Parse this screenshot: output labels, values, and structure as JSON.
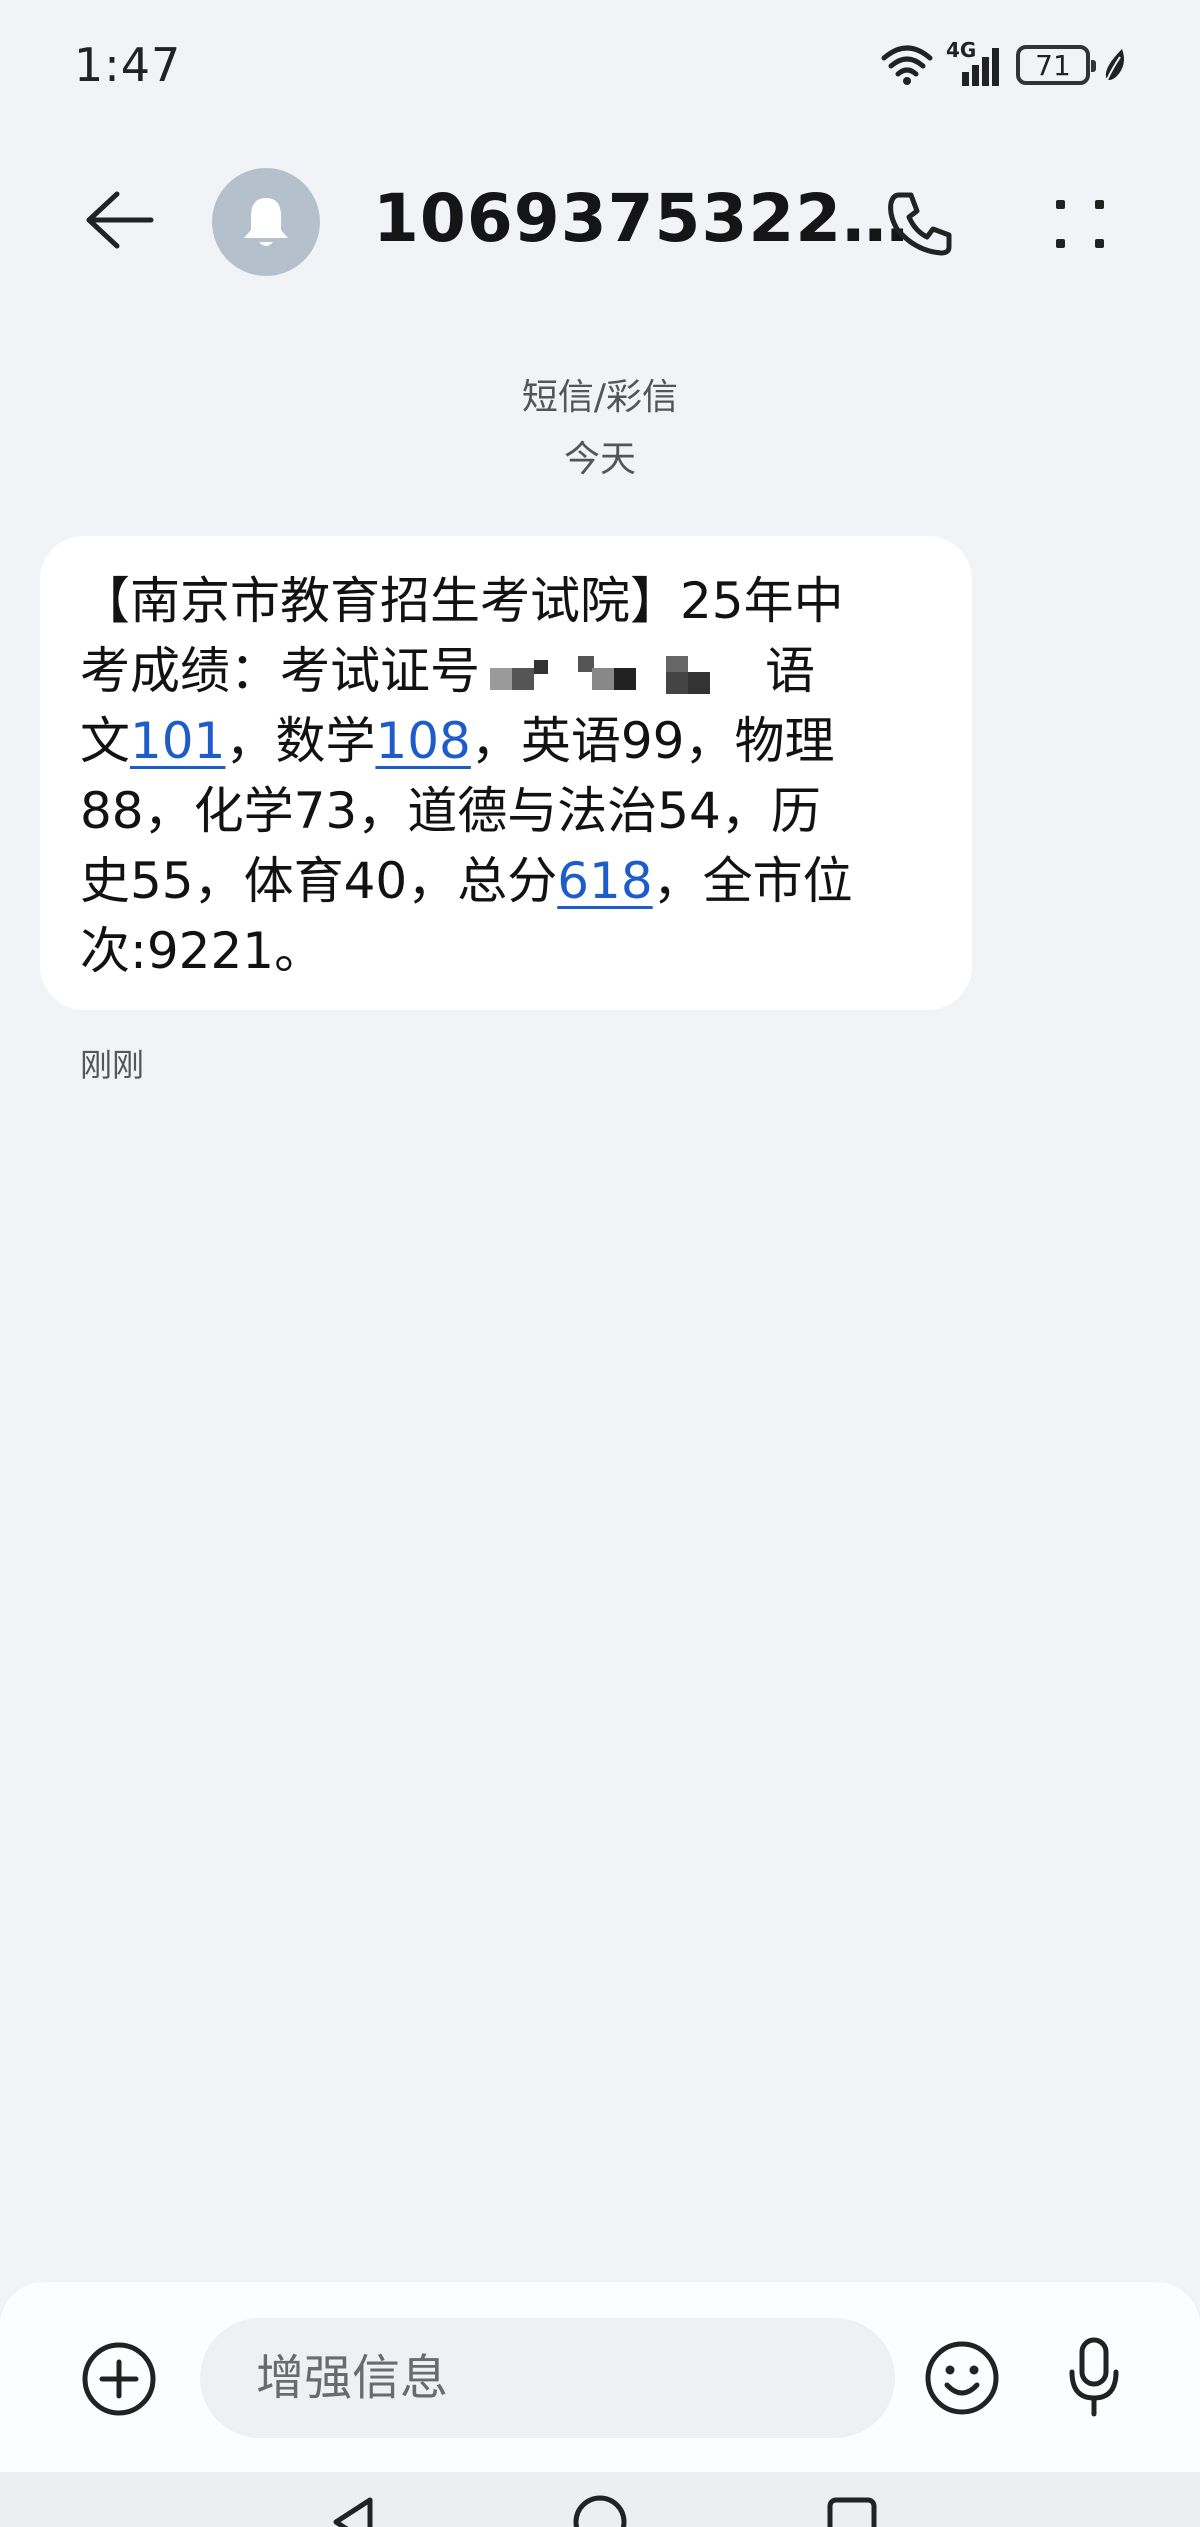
{
  "status_bar": {
    "time": "1:47",
    "network": "4G",
    "battery": "71"
  },
  "header": {
    "title": "1069375322…",
    "back_icon": "back-arrow-icon",
    "avatar_icon": "bell-icon",
    "call_icon": "phone-icon",
    "more_icon": "more-dots-icon"
  },
  "conversation": {
    "message_type": "短信/彩信",
    "date_separator": "今天",
    "message": {
      "line1": "【南京市教育招生考试院】25年中",
      "line2_pre": "考成绩：考试证号",
      "line2_post": "语",
      "line3_a": "文",
      "link1": "101",
      "line3_b": "，数学",
      "link2": "108",
      "line3_c": "，英语99，物理",
      "line4": "88，化学73，道德与法治54，历",
      "line5_a": "史55，体育40，总分",
      "link3": "618",
      "line5_b": "，全市位",
      "line6": "次:9221。",
      "time": "刚刚"
    }
  },
  "composer": {
    "placeholder": "增强信息",
    "add_icon": "plus-circle-icon",
    "emoji_icon": "smiley-icon",
    "mic_icon": "microphone-icon"
  },
  "colors": {
    "background": "#f1f3f6",
    "bubble": "#ffffff",
    "link": "#1e5cc9",
    "avatar": "#b4c1cd"
  }
}
